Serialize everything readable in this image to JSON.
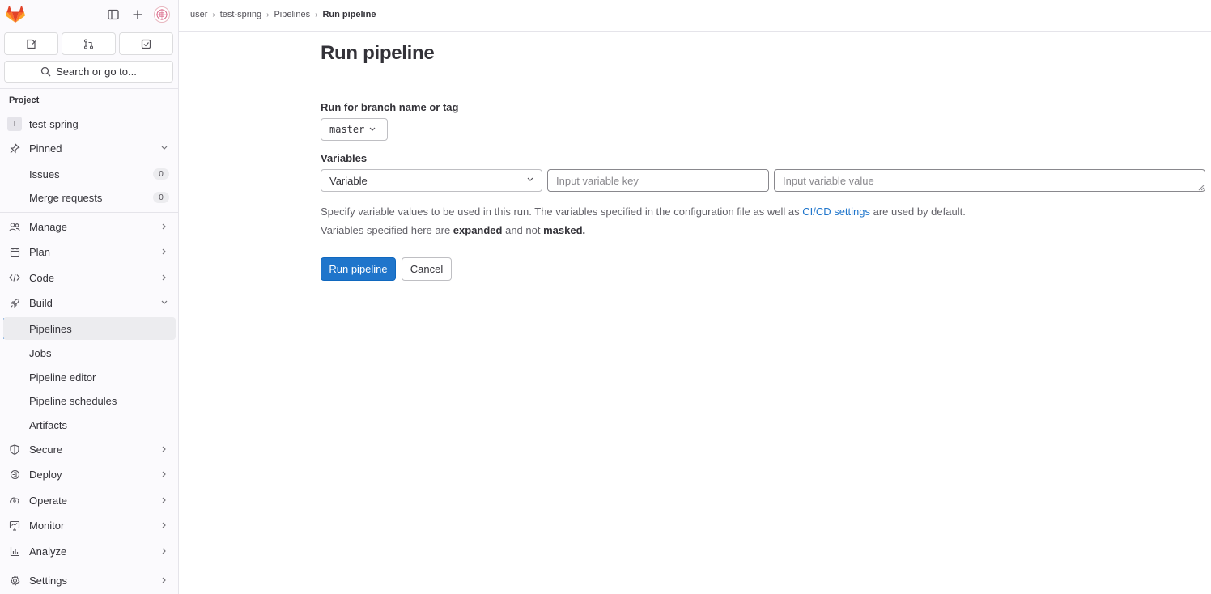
{
  "sidebar": {
    "search_label": "Search or go to...",
    "section_label": "Project",
    "project": {
      "initial": "T",
      "name": "test-spring"
    },
    "items": [
      {
        "label": "Pinned",
        "icon": "pin-icon"
      },
      {
        "label": "Issues",
        "count": "0"
      },
      {
        "label": "Merge requests",
        "count": "0"
      },
      {
        "label": "Manage",
        "icon": "users-icon"
      },
      {
        "label": "Plan",
        "icon": "calendar-icon"
      },
      {
        "label": "Code",
        "icon": "code-icon"
      },
      {
        "label": "Build",
        "icon": "rocket-icon"
      },
      {
        "label": "Pipelines"
      },
      {
        "label": "Jobs"
      },
      {
        "label": "Pipeline editor"
      },
      {
        "label": "Pipeline schedules"
      },
      {
        "label": "Artifacts"
      },
      {
        "label": "Secure",
        "icon": "shield-icon"
      },
      {
        "label": "Deploy",
        "icon": "deploy-icon"
      },
      {
        "label": "Operate",
        "icon": "cloud-icon"
      },
      {
        "label": "Monitor",
        "icon": "monitor-icon"
      },
      {
        "label": "Analyze",
        "icon": "chart-icon"
      },
      {
        "label": "Settings",
        "icon": "gear-icon"
      }
    ]
  },
  "breadcrumb": {
    "items": [
      "user",
      "test-spring",
      "Pipelines",
      "Run pipeline"
    ]
  },
  "main": {
    "title": "Run pipeline",
    "branch_label": "Run for branch name or tag",
    "branch_value": "master",
    "variables_label": "Variables",
    "variable_type": "Variable",
    "key_placeholder": "Input variable key",
    "value_placeholder": "Input variable value",
    "help_line1_pre": "Specify variable values to be used in this run. The variables specified in the configuration file as well as ",
    "help_line1_link": "CI/CD settings",
    "help_line1_post": " are used by default.",
    "help_line2_pre": "Variables specified here are ",
    "help_line2_b1": "expanded",
    "help_line2_mid": " and not ",
    "help_line2_b2": "masked.",
    "run_button": "Run pipeline",
    "cancel_button": "Cancel"
  },
  "colors": {
    "accent": "#1f75cb",
    "sidebar_bg": "#fbfafd",
    "brand_orange": "#e24329"
  }
}
